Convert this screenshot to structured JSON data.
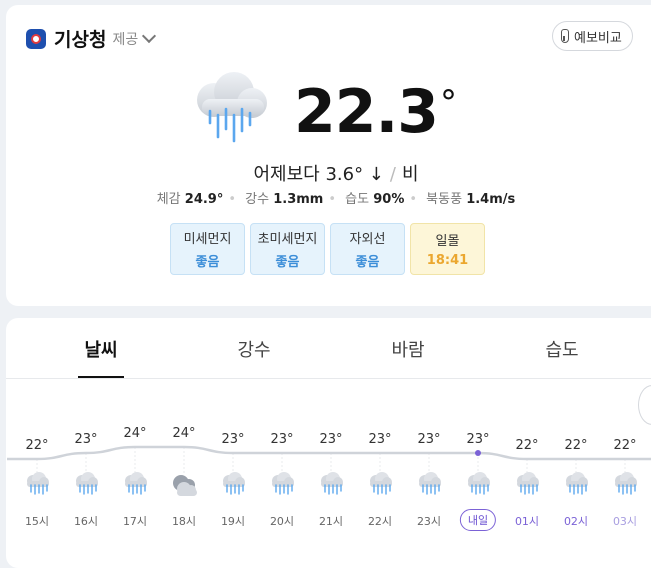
{
  "provider": {
    "name": "기상청",
    "sub": "제공"
  },
  "compare_button": {
    "label": "예보비교",
    "icon": "thermometer-icon"
  },
  "current": {
    "temp": "22.3",
    "deg": "°",
    "condition_icon": "rain-cloud-icon",
    "diff_label": "어제보다",
    "diff_value": "3.6° ↓",
    "slash": "/",
    "condition": "비",
    "details": [
      {
        "label": "체감",
        "value": "24.9°"
      },
      {
        "label": "강수",
        "value": "1.3mm"
      },
      {
        "label": "습도",
        "value": "90%"
      },
      {
        "label": "북동풍",
        "value": "1.4m/s"
      }
    ]
  },
  "badges": [
    {
      "label": "미세먼지",
      "value": "좋음",
      "style": "blue"
    },
    {
      "label": "초미세먼지",
      "value": "좋음",
      "style": "blue"
    },
    {
      "label": "자외선",
      "value": "좋음",
      "style": "blue"
    },
    {
      "label": "일몰",
      "value": "18:41",
      "style": "yellow"
    }
  ],
  "tabs": [
    {
      "label": "날씨",
      "active": true
    },
    {
      "label": "강수",
      "active": false
    },
    {
      "label": "바람",
      "active": false
    },
    {
      "label": "습도",
      "active": false
    }
  ],
  "hourly": [
    {
      "time": "15시",
      "temp": "22°",
      "icon": "rain-cloud-icon"
    },
    {
      "time": "16시",
      "temp": "23°",
      "icon": "rain-cloud-icon"
    },
    {
      "time": "17시",
      "temp": "24°",
      "icon": "rain-cloud-icon"
    },
    {
      "time": "18시",
      "temp": "24°",
      "icon": "cloudy-icon"
    },
    {
      "time": "19시",
      "temp": "23°",
      "icon": "rain-cloud-icon"
    },
    {
      "time": "20시",
      "temp": "23°",
      "icon": "rain-cloud-icon"
    },
    {
      "time": "21시",
      "temp": "23°",
      "icon": "rain-cloud-icon"
    },
    {
      "time": "22시",
      "temp": "23°",
      "icon": "rain-cloud-icon"
    },
    {
      "time": "23시",
      "temp": "23°",
      "icon": "rain-cloud-icon"
    },
    {
      "time": "내일",
      "temp": "23°",
      "icon": "rain-cloud-icon",
      "pill": true
    },
    {
      "time": "01시",
      "temp": "22°",
      "icon": "rain-cloud-icon",
      "tomorrow": true
    },
    {
      "time": "02시",
      "temp": "22°",
      "icon": "rain-cloud-icon",
      "tomorrow": true
    },
    {
      "time": "03시",
      "temp": "22°",
      "icon": "rain-cloud-icon",
      "tomorrow": true,
      "faded": true
    }
  ],
  "colors": {
    "accent": "#7b62d6",
    "rain": "#5ba7ee",
    "line": "#cfd3d9"
  }
}
